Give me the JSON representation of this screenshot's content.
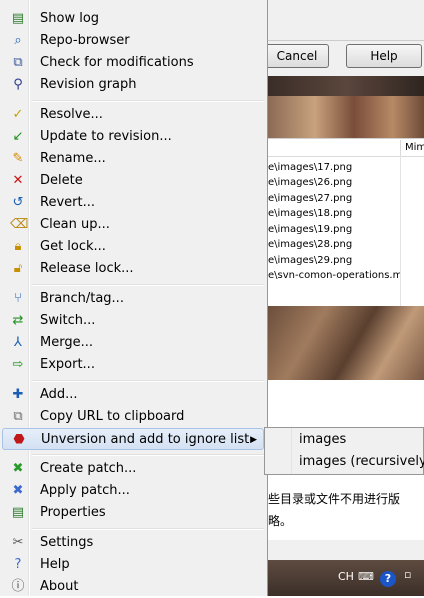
{
  "background": {
    "buttons": {
      "cancel": "Cancel",
      "help": "Help"
    },
    "list_header_col2": "Mim",
    "files": [
      "e\\images\\17.png",
      "e\\images\\26.png",
      "e\\images\\27.png",
      "e\\images\\18.png",
      "e\\images\\19.png",
      "e\\images\\28.png",
      "e\\images\\29.png",
      "e\\svn-comon-operations.md"
    ],
    "cn_line1": "些目录或文件不用进行版",
    "cn_line2": "略。",
    "tray_lang": "CH",
    "tray_help": "?"
  },
  "menu": {
    "items": [
      {
        "label": "Show log",
        "icon": "log-icon"
      },
      {
        "label": "Repo-browser",
        "icon": "repo-browser-icon"
      },
      {
        "label": "Check for modifications",
        "icon": "check-modifications-icon"
      },
      {
        "label": "Revision graph",
        "icon": "revision-graph-icon"
      },
      {
        "label": "Resolve...",
        "icon": "resolve-icon"
      },
      {
        "label": "Update to revision...",
        "icon": "update-icon"
      },
      {
        "label": "Rename...",
        "icon": "rename-icon"
      },
      {
        "label": "Delete",
        "icon": "delete-icon"
      },
      {
        "label": "Revert...",
        "icon": "revert-icon"
      },
      {
        "label": "Clean up...",
        "icon": "cleanup-icon"
      },
      {
        "label": "Get lock...",
        "icon": "lock-icon"
      },
      {
        "label": "Release lock...",
        "icon": "unlock-icon"
      },
      {
        "label": "Branch/tag...",
        "icon": "branch-icon"
      },
      {
        "label": "Switch...",
        "icon": "switch-icon"
      },
      {
        "label": "Merge...",
        "icon": "merge-icon"
      },
      {
        "label": "Export...",
        "icon": "export-icon"
      },
      {
        "label": "Add...",
        "icon": "add-icon"
      },
      {
        "label": "Copy URL to clipboard",
        "icon": "copy-icon"
      },
      {
        "label": "Unversion and add to ignore list",
        "icon": "ignore-icon"
      },
      {
        "label": "Create patch...",
        "icon": "create-patch-icon"
      },
      {
        "label": "Apply patch...",
        "icon": "apply-patch-icon"
      },
      {
        "label": "Properties",
        "icon": "properties-icon"
      },
      {
        "label": "Settings",
        "icon": "settings-icon"
      },
      {
        "label": "Help",
        "icon": "help-icon"
      },
      {
        "label": "About",
        "icon": "about-icon"
      }
    ]
  },
  "submenu": {
    "items": [
      "images",
      "images (recursively)"
    ]
  },
  "colors": {
    "highlight_border": "#a8c3e6",
    "menu_bg": "#f0f0f0"
  }
}
